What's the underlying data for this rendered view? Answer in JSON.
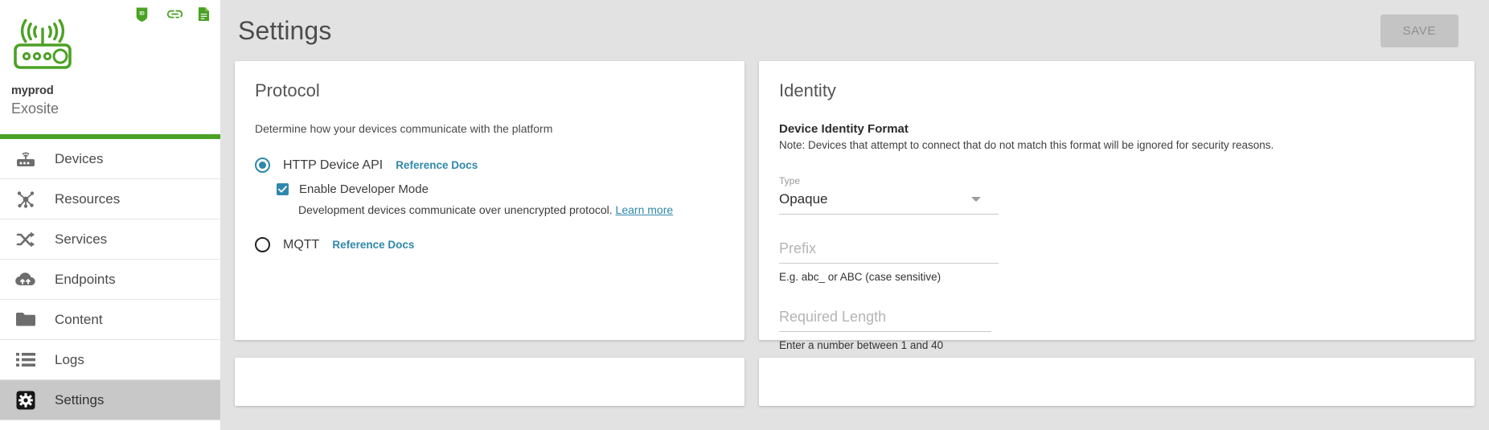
{
  "sidebar": {
    "top_icons": [
      {
        "name": "id-badge-icon",
        "label": "ID"
      },
      {
        "name": "link-icon",
        "label": "Link"
      },
      {
        "name": "document-icon",
        "label": "Document"
      }
    ],
    "device_logo_name": "router-device-logo",
    "product_name": "myprod",
    "org_name": "Exosite",
    "accent_color": "#4ba124",
    "items": [
      {
        "label": "Devices",
        "icon": "router-icon",
        "selected": false
      },
      {
        "label": "Resources",
        "icon": "hub-nodes-icon",
        "selected": false
      },
      {
        "label": "Services",
        "icon": "shuffle-icon",
        "selected": false
      },
      {
        "label": "Endpoints",
        "icon": "cloud-upload-icon",
        "selected": false
      },
      {
        "label": "Content",
        "icon": "folder-icon",
        "selected": false
      },
      {
        "label": "Logs",
        "icon": "list-icon",
        "selected": false
      },
      {
        "label": "Settings",
        "icon": "gear-icon",
        "selected": true
      }
    ]
  },
  "header": {
    "title": "Settings",
    "save_label": "SAVE",
    "save_disabled": true
  },
  "protocol_card": {
    "title": "Protocol",
    "subtitle": "Determine how your devices communicate with the platform",
    "accent_color": "#2f88ab",
    "options": [
      {
        "label": "HTTP Device API",
        "link_label": "Reference Docs",
        "selected": true
      },
      {
        "label": "MQTT",
        "link_label": "Reference Docs",
        "selected": false
      }
    ],
    "developer_mode": {
      "label": "Enable Developer Mode",
      "checked": true,
      "helper_text": "Development devices communicate over unencrypted protocol.",
      "helper_link": "Learn more"
    }
  },
  "identity_card": {
    "title": "Identity",
    "section_heading": "Device Identity Format",
    "note": "Note: Devices that attempt to connect that do not match this format will be ignored for security reasons.",
    "fields": [
      {
        "name": "type",
        "label": "Type",
        "value": "Opaque",
        "kind": "select"
      },
      {
        "name": "prefix",
        "placeholder": "Prefix",
        "value": "",
        "help": "E.g. abc_ or ABC (case sensitive)",
        "kind": "text"
      },
      {
        "name": "required-length",
        "placeholder": "Required Length",
        "value": "",
        "help": "Enter a number between 1 and 40",
        "kind": "text"
      }
    ]
  }
}
